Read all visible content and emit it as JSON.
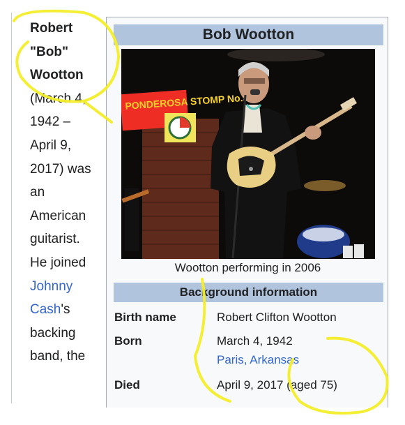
{
  "article": {
    "name_bold": "Robert \"Bob\" Wootton",
    "intro": " (March 4, 1942 – April 9, 2017) was an American guitarist. He joined ",
    "link_johnny_cash": "Johnny Cash",
    "after_link": "'s backing band, the"
  },
  "infobox": {
    "title": "Bob Wootton",
    "image_caption": "Wootton performing in 2006",
    "photo_banner_text": "PONDEROSA STOMP No.5",
    "section_header": "Background information",
    "rows": [
      {
        "label": "Birth name",
        "value": "Robert Clifton Wootton"
      },
      {
        "label": "Born",
        "value": "March 4, 1942",
        "link": "Paris, Arkansas"
      },
      {
        "label": "Died",
        "value": "April 9, 2017 (aged 75)"
      }
    ]
  },
  "colors": {
    "link": "#3366cc",
    "infobox_header": "#b0c4de",
    "highlighter": "#f3ee2a"
  }
}
